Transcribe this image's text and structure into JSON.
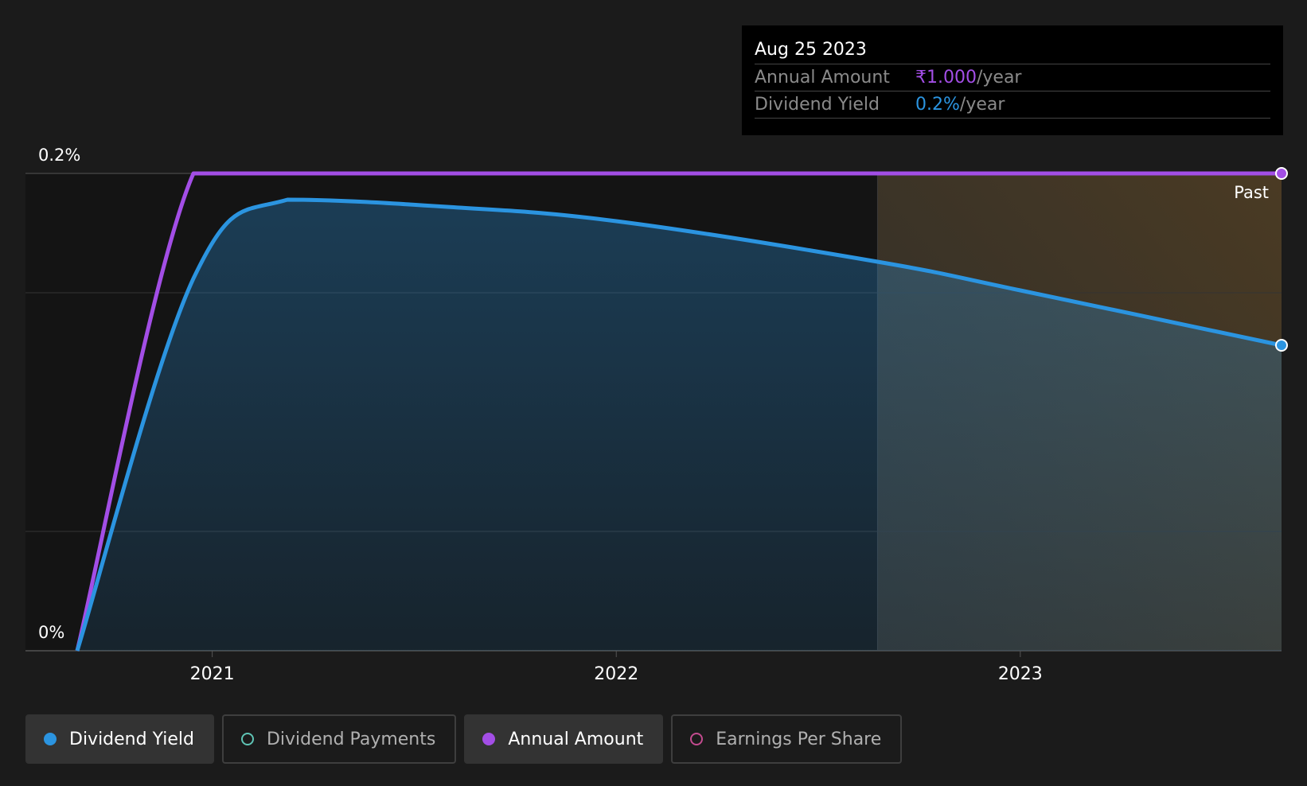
{
  "chart_data": {
    "type": "area",
    "ylim": [
      0,
      0.2
    ],
    "y_tick_labels": [
      "0%",
      "0.2%"
    ],
    "x_tick_labels": [
      "2021",
      "2022",
      "2023"
    ],
    "x_ticks": [
      "2021-01-01",
      "2022-01-01",
      "2023-01-01"
    ],
    "x_domain": [
      "2020-09-01",
      "2023-08-25"
    ],
    "past_marker": {
      "label": "Past",
      "start": "2022-08-25",
      "end": "2023-08-25"
    },
    "series": [
      {
        "name": "Annual Amount",
        "color": "#a34ee6",
        "unit": "₹/year",
        "x": [
          "2020-09-01",
          "2020-12-15",
          "2021-03-10",
          "2022-01-01",
          "2023-01-01",
          "2023-08-25"
        ],
        "values": [
          0,
          0.2,
          0.2,
          0.2,
          0.2,
          0.2
        ]
      },
      {
        "name": "Dividend Yield",
        "color": "#2b94e0",
        "unit": "%",
        "x": [
          "2020-09-01",
          "2020-12-15",
          "2021-03-10",
          "2021-08-01",
          "2022-01-01",
          "2022-08-25",
          "2023-01-01",
          "2023-08-25"
        ],
        "values": [
          0,
          0.156,
          0.189,
          0.186,
          0.18,
          0.163,
          0.151,
          0.128
        ]
      }
    ]
  },
  "tooltip": {
    "date": "Aug 25 2023",
    "rows": [
      {
        "label": "Annual Amount",
        "value": "₹1.000",
        "suffix": "/year",
        "color": "#a34ee6"
      },
      {
        "label": "Dividend Yield",
        "value": "0.2%",
        "suffix": "/year",
        "color": "#2b94e0"
      }
    ]
  },
  "legend": [
    {
      "label": "Dividend Yield",
      "active": true,
      "color": "#2b94e0",
      "filled": true
    },
    {
      "label": "Dividend Payments",
      "active": false,
      "color": "#5fc4b5",
      "filled": false
    },
    {
      "label": "Annual Amount",
      "active": true,
      "color": "#a34ee6",
      "filled": true
    },
    {
      "label": "Earnings Per Share",
      "active": false,
      "color": "#c34b8f",
      "filled": false
    }
  ]
}
